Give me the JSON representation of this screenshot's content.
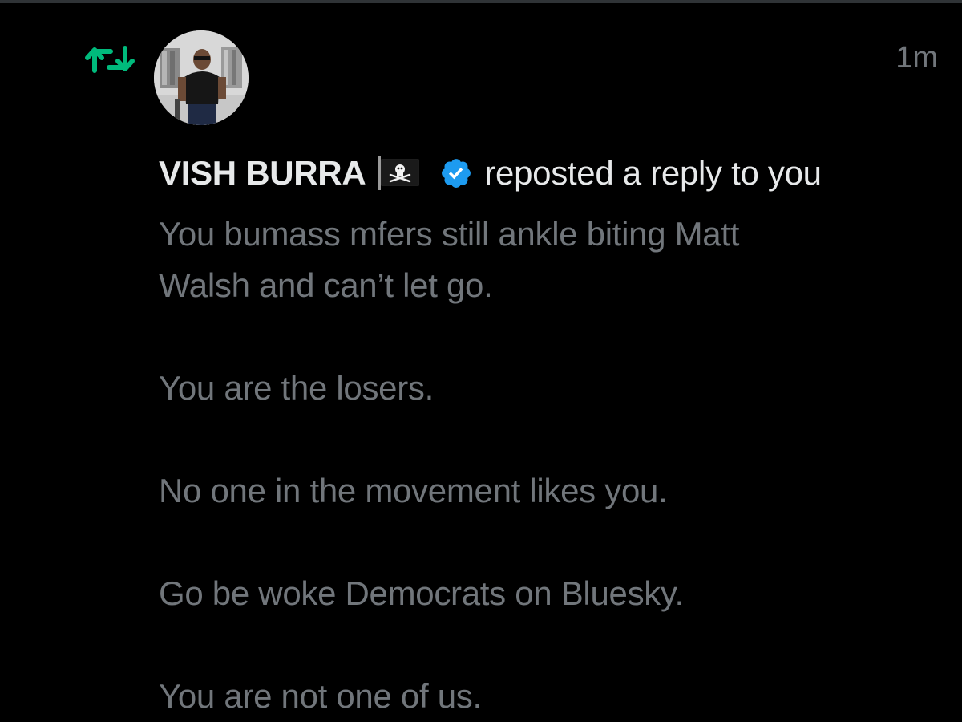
{
  "notification": {
    "type_icon": "repost-icon",
    "timestamp": "1m",
    "user": {
      "name": "VISH BURRA",
      "flag_icon": "pirate-flag-icon",
      "verified_icon": "verified-badge-icon"
    },
    "action": "reposted a reply to you",
    "post": {
      "line1": "You bumass mfers still ankle biting Matt",
      "line2": "Walsh and can’t let go.",
      "paragraph2": "You are the losers.",
      "paragraph3": "No one in the movement likes you.",
      "paragraph4": "Go be woke Democrats on Bluesky.",
      "paragraph5": "You are not one of us."
    }
  },
  "colors": {
    "background": "#000000",
    "primary_text": "#e7e9ea",
    "secondary_text": "#71767b",
    "repost_green": "#00ba7c",
    "verified_blue": "#1d9bf0"
  }
}
